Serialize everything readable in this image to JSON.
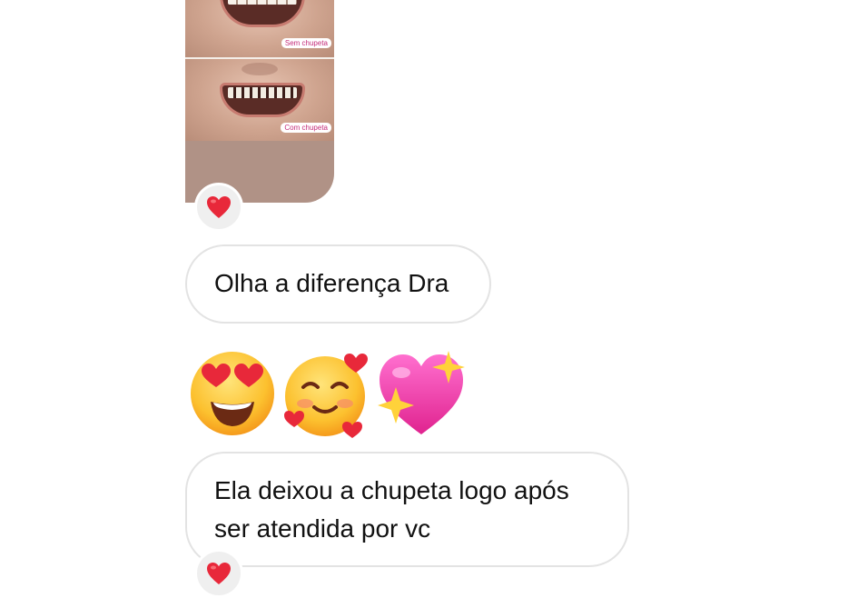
{
  "chat": {
    "photo": {
      "top_label": "Sem chupeta",
      "bottom_label": "Com chupeta"
    },
    "reactions": {
      "photo_reaction": "heart",
      "message2_reaction": "heart"
    },
    "messages": [
      {
        "text": "Olha a diferença Dra"
      },
      {
        "emojis": [
          "heart-eyes-emoji",
          "smiling-face-with-hearts-emoji",
          "sparkling-heart-emoji"
        ]
      },
      {
        "text_line1": "Ela deixou a chupeta logo após",
        "text_line2": "ser atendida por vc"
      }
    ]
  },
  "colors": {
    "bubble_border": "#e3e3e3",
    "reaction_bg": "#efefef",
    "heart_red": "#e8283a",
    "tag_pink": "#c42c7a"
  }
}
